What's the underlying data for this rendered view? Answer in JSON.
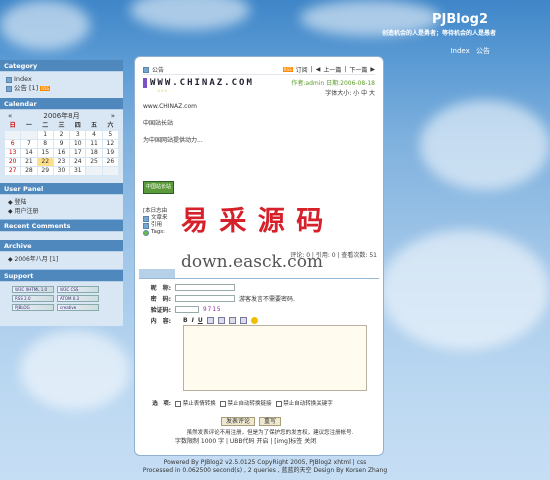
{
  "header": {
    "title": "PJBlog2",
    "subtitle": "创造机会的人是勇者；等待机会的人是愚者",
    "nav": [
      "Index",
      "公告"
    ]
  },
  "sidebar": {
    "category": {
      "title": "Category",
      "items": [
        {
          "label": "Index"
        },
        {
          "label": "公告",
          "count": "[1]"
        }
      ]
    },
    "calendar": {
      "title": "Calendar",
      "prev": "«",
      "next": "»",
      "month": "2006年8月",
      "weekdays": [
        "日",
        "一",
        "二",
        "三",
        "四",
        "五",
        "六"
      ],
      "weeks": [
        [
          "",
          "",
          "1",
          "2",
          "3",
          "4",
          "5"
        ],
        [
          "6",
          "7",
          "8",
          "9",
          "10",
          "11",
          "12"
        ],
        [
          "13",
          "14",
          "15",
          "16",
          "17",
          "18",
          "19"
        ],
        [
          "20",
          "21",
          "22",
          "23",
          "24",
          "25",
          "26"
        ],
        [
          "27",
          "28",
          "29",
          "30",
          "31",
          "",
          ""
        ]
      ],
      "today": "22"
    },
    "user_panel": {
      "title": "User Panel",
      "items": [
        "登陆",
        "用户注册"
      ]
    },
    "recent_comments": {
      "title": "Recent Comments"
    },
    "archive": {
      "title": "Archive",
      "items": [
        "2006年八月 [1]"
      ]
    },
    "support": {
      "title": "Support",
      "badges": [
        [
          "W3C XHTML 1.0",
          "W3C CSS"
        ],
        [
          "RSS 2.0",
          "ATOM 0.3"
        ],
        [
          "PJBLOG",
          "creative"
        ]
      ]
    }
  },
  "post": {
    "category": "公告",
    "subscribe": "订阅",
    "prev": "上一篇",
    "next": "下一篇",
    "title": "WWW.CHINAZ.COM",
    "author_date": "作者:admin 日期:2006-08-18",
    "font_size": "字体大小: 小 中 大",
    "stars": "☆☆☆",
    "body": [
      "www.CHINAZ.com",
      "中国站长站",
      "为中国网站提供动力..."
    ],
    "site_badge": "中国站长站",
    "tag_lines": [
      "[本日志由",
      "文章来",
      "引用",
      "Tags:"
    ],
    "stats": "评论: 0 | 引用: 0 | 查看次数: 51"
  },
  "watermark": {
    "cn": "易 采 源 码",
    "url": "down.easck.com"
  },
  "comment_form": {
    "nickname_label": "昵　称:",
    "password_label": "密　码:",
    "password_hint": "游客发言不需要密码.",
    "captcha_label": "验证码:",
    "captcha_value": "9715",
    "content_label": "内　容:",
    "toolbar": [
      "B",
      "I",
      "U"
    ],
    "options_label": "选　项:",
    "options": [
      "禁止表情转换",
      "禁止自动转换链接",
      "禁止自动转换关键字"
    ],
    "submit": "发表评论",
    "reset": "重写",
    "notice": "虽然发表评论不用注册，但是为了保护您的发言权，建议您注册帐号.",
    "limits": "字数限制 1000 字 | UBB代码 开启 | [img]标签 关闭"
  },
  "footer": {
    "line1": "Powered By PJBlog2 v2.5.0125 CopyRight 2005, PJBlog2 xhtml | css",
    "line2": "Processed in 0.062500 second(s) , 2 queries , 蓝蓝的天空 Design By Korsen Zhang"
  },
  "colors": {
    "sidebar_head": "#4f88bd",
    "sidebar_body": "#d9e7f5",
    "date_green": "#5a9b2a",
    "watermark_red": "#d6202a"
  }
}
